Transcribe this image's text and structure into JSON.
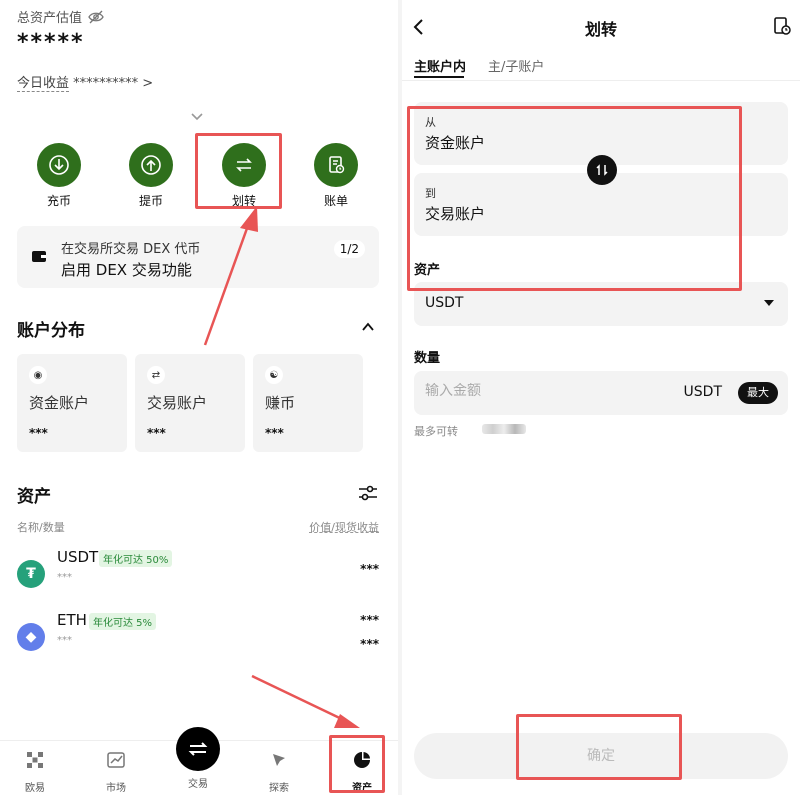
{
  "left": {
    "header": {
      "total_label": "总资产估值",
      "total_value": "*****",
      "today_label": "今日收益",
      "today_value": "**********",
      "today_arrow": ">"
    },
    "actions": [
      {
        "label": "充币",
        "icon": "deposit-icon"
      },
      {
        "label": "提币",
        "icon": "withdraw-icon"
      },
      {
        "label": "划转",
        "icon": "transfer-icon"
      },
      {
        "label": "账单",
        "icon": "bill-icon"
      }
    ],
    "promo": {
      "line1": "在交易所交易 DEX 代币",
      "line2": "启用 DEX 交易功能",
      "page": "1/2"
    },
    "distribution": {
      "title": "账户分布",
      "accounts": [
        {
          "name": "资金账户",
          "value": "***"
        },
        {
          "name": "交易账户",
          "value": "***"
        },
        {
          "name": "赚币",
          "value": "***"
        }
      ]
    },
    "assets": {
      "title": "资产",
      "col_left": "名称/数量",
      "col_right": "价值/现货收益",
      "items": [
        {
          "symbol": "USDT",
          "tag": "年化可达 50%",
          "sub": "***",
          "value": "***",
          "value2": "",
          "color": "#26a17b"
        },
        {
          "symbol": "ETH",
          "tag": "年化可达 5%",
          "sub": "***",
          "value": "***",
          "value2": "***",
          "color": "#627eea"
        }
      ]
    },
    "tabbar": {
      "items": [
        {
          "label": "欧易"
        },
        {
          "label": "市场"
        },
        {
          "label": "交易"
        },
        {
          "label": "探索"
        },
        {
          "label": "资产"
        }
      ]
    }
  },
  "right": {
    "title": "划转",
    "tabs": [
      {
        "label": "主账户内"
      },
      {
        "label": "主/子账户"
      }
    ],
    "from": {
      "label": "从",
      "value": "资金账户"
    },
    "to": {
      "label": "到",
      "value": "交易账户"
    },
    "asset": {
      "label": "资产",
      "value": "USDT"
    },
    "amount": {
      "label": "数量",
      "placeholder": "输入金额",
      "unit": "USDT",
      "max": "最大"
    },
    "available_label": "最多可转",
    "confirm": "确定"
  },
  "colors": {
    "accent_green": "#2f6f1c",
    "highlight_red": "#e85555"
  }
}
